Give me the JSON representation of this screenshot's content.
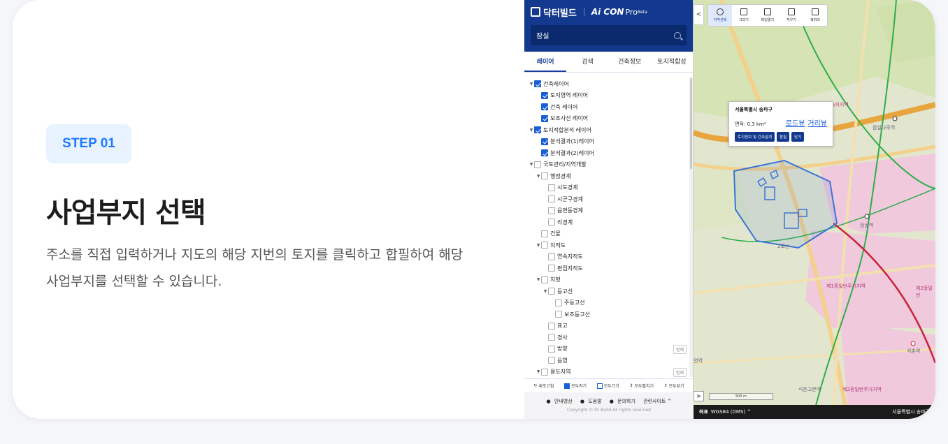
{
  "left": {
    "step_label": "STEP 01",
    "title": "사업부지 선택",
    "description": "주소를 직접 입력하거나 지도의 해당 지번의 토지를 클릭하고 합필하여 해당 사업부지를 선택할 수 있습니다."
  },
  "app": {
    "brand_name": "닥터빌드",
    "product_name": "Ai CON",
    "product_suffix": "Pro",
    "product_tag": "Beta",
    "search": {
      "value": "잠실"
    },
    "tabs": [
      "레이어",
      "검색",
      "건축정보",
      "토지적합성"
    ],
    "active_tab": "레이어",
    "tree": [
      {
        "label": "건축레이어",
        "level": 0,
        "checked": true,
        "arrow": true
      },
      {
        "label": "토지영역 레이어",
        "level": 1,
        "checked": true
      },
      {
        "label": "건축 레이어",
        "level": 1,
        "checked": true
      },
      {
        "label": "보조사선 레이어",
        "level": 1,
        "checked": true
      },
      {
        "label": "토지적합분석 레이어",
        "level": 0,
        "checked": true,
        "arrow": true
      },
      {
        "label": "분석결과(1)레이어",
        "level": 1,
        "checked": true
      },
      {
        "label": "분석결과(2)레이어",
        "level": 1,
        "checked": true
      },
      {
        "label": "국토관리/지역개발",
        "level": 0,
        "checked": false,
        "arrow": true
      },
      {
        "label": "행정경계",
        "level": 1,
        "checked": false,
        "arrow": true
      },
      {
        "label": "시도경계",
        "level": 2,
        "checked": false
      },
      {
        "label": "시군구경계",
        "level": 2,
        "checked": false
      },
      {
        "label": "읍면동경계",
        "level": 2,
        "checked": false
      },
      {
        "label": "리경계",
        "level": 2,
        "checked": false
      },
      {
        "label": "건물",
        "level": 1,
        "checked": false
      },
      {
        "label": "지적도",
        "level": 1,
        "checked": false,
        "arrow": true
      },
      {
        "label": "연속지적도",
        "level": 2,
        "checked": false
      },
      {
        "label": "편집지적도",
        "level": 2,
        "checked": false
      },
      {
        "label": "지형",
        "level": 1,
        "checked": false,
        "arrow": true
      },
      {
        "label": "등고선",
        "level": 2,
        "checked": false,
        "arrow": true
      },
      {
        "label": "주등고선",
        "level": 3,
        "checked": false
      },
      {
        "label": "보조등고선",
        "level": 3,
        "checked": false
      },
      {
        "label": "표고",
        "level": 2,
        "checked": false
      },
      {
        "label": "경사",
        "level": 2,
        "checked": false
      },
      {
        "label": "방향",
        "level": 2,
        "checked": false,
        "range": "범례"
      },
      {
        "label": "음영",
        "level": 2,
        "checked": false
      },
      {
        "label": "용도지역",
        "level": 1,
        "checked": false,
        "arrow": true,
        "range": "범례"
      }
    ],
    "actions": {
      "refresh": "새로고침",
      "check_all": "모두켜기",
      "uncheck_all": "모두끄기",
      "expand_all": "모두펼치기",
      "collapse_all": "모두닫기"
    },
    "footer": {
      "guide_video": "안내영상",
      "help": "도움말",
      "contact": "문의하기",
      "related_sites": "관련사이트 ^",
      "copyright": "Copyright © Dr Build All rights reserved"
    }
  },
  "map": {
    "collapse_label": "<",
    "toolbar": [
      {
        "label": "지적선택",
        "icon": "target-icon",
        "active": true
      },
      {
        "label": "그리기",
        "icon": "draw-icon",
        "active": false
      },
      {
        "label": "파일열기",
        "icon": "folder-icon",
        "active": false
      },
      {
        "label": "지우기",
        "icon": "trash-icon",
        "active": false
      },
      {
        "label": "북마크",
        "icon": "bookmark-icon",
        "active": false
      }
    ],
    "popup": {
      "title": "서울특별시 송파구",
      "area": "면적: 0.3 km²",
      "road_view": "로드뷰",
      "street_view": "거리뷰",
      "btn_info": "토지정보 및 건축설계",
      "btn_merge": "합필",
      "btn_close": "닫기"
    },
    "labels": {
      "residential_1": "제1종일반주거지역",
      "residential_2": "제2종일반",
      "residential_3": "제2종일반주거지역",
      "station_1": "잠실나루역",
      "station_2": "잠실역",
      "station_3": "석촌역",
      "station_4": "석촌고분역",
      "line2": "2호선",
      "zone_top": "녹지지역",
      "left_edge": "연역"
    },
    "scale": "500 m",
    "expand_label": ">",
    "status": {
      "coord_label": "좌표",
      "coord_system": "WGS84 (DMS) ^",
      "region": "서울특별시 송파구"
    },
    "colors": {
      "accent": "#12398d",
      "parcel": "#3a74d6",
      "residential": "#f0c9dc",
      "subway_green": "#2eae4a",
      "subway_red": "#c8233a"
    }
  }
}
